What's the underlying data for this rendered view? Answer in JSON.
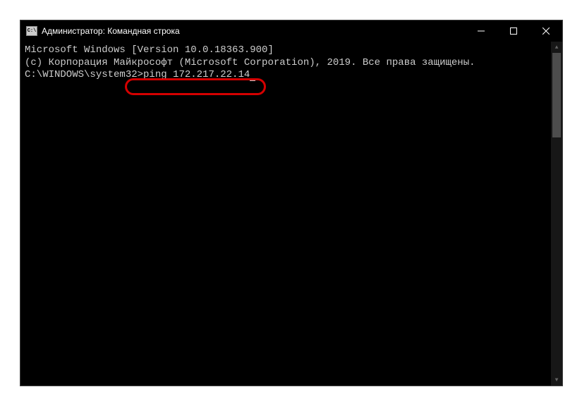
{
  "titlebar": {
    "icon_label": "C:\\",
    "title": "Администратор: Командная строка"
  },
  "window_controls": {
    "minimize": "—",
    "maximize": "□",
    "close": "✕"
  },
  "terminal": {
    "line1": "Microsoft Windows [Version 10.0.18363.900]",
    "line2": "(c) Корпорация Майкрософт (Microsoft Corporation), 2019. Все права защищены.",
    "blank": "",
    "prompt_path": "C:\\WINDOWS\\system32>",
    "command": "ping 172.217.22.14"
  },
  "scrollbar_arrows": {
    "up": "▲",
    "down": "▼"
  }
}
